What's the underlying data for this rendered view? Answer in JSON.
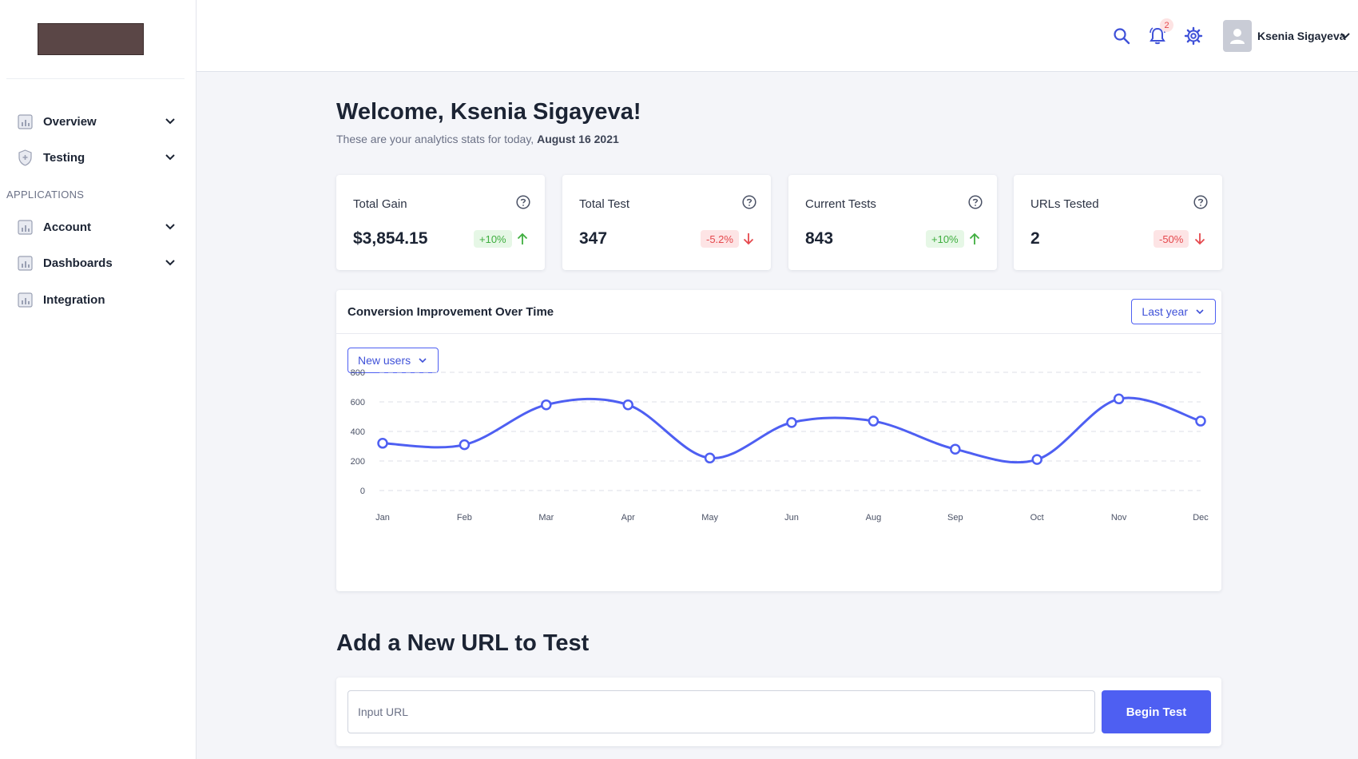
{
  "sidebar": {
    "items": [
      {
        "label": "Overview"
      },
      {
        "label": "Testing"
      },
      {
        "label": "Account"
      },
      {
        "label": "Dashboards"
      },
      {
        "label": "Integration"
      }
    ],
    "section_label": "APPLICATIONS"
  },
  "header": {
    "notification_count": "2",
    "user_name": "Ksenia Sigayeva"
  },
  "welcome": {
    "title": "Welcome, Ksenia Sigayeva!",
    "subtitle_prefix": "These are your analytics stats for today, ",
    "subtitle_date": "August 16 2021"
  },
  "stats": [
    {
      "label": "Total Gain",
      "value": "$3,854.15",
      "change": "+10%",
      "trend": "up"
    },
    {
      "label": "Total Test",
      "value": "347",
      "change": "-5.2%",
      "trend": "down"
    },
    {
      "label": "Current Tests",
      "value": "843",
      "change": "+10%",
      "trend": "up"
    },
    {
      "label": "URLs Tested",
      "value": "2",
      "change": "-50%",
      "trend": "down"
    }
  ],
  "chart": {
    "title": "Conversion Improvement Over Time",
    "period_select": "Last year",
    "metric_select": "New users"
  },
  "chart_data": {
    "type": "line",
    "title": "Conversion Improvement Over Time",
    "xlabel": "",
    "ylabel": "",
    "categories": [
      "Jan",
      "Feb",
      "Mar",
      "Apr",
      "May",
      "Jun",
      "Aug",
      "Sep",
      "Oct",
      "Nov",
      "Dec"
    ],
    "series": [
      {
        "values": [
          320,
          310,
          580,
          580,
          220,
          460,
          470,
          280,
          210,
          620,
          470
        ]
      }
    ],
    "ylim": [
      0,
      800
    ],
    "yticks": [
      0,
      200,
      400,
      600,
      800
    ],
    "grid": true,
    "line_color": "#4e5ff2"
  },
  "add_url": {
    "title": "Add a New URL to Test",
    "input_placeholder": "Input URL",
    "button_label": "Begin Test"
  },
  "colors": {
    "accent": "#4e5ff2",
    "positive": "#3fae3f",
    "negative": "#e5484d"
  }
}
